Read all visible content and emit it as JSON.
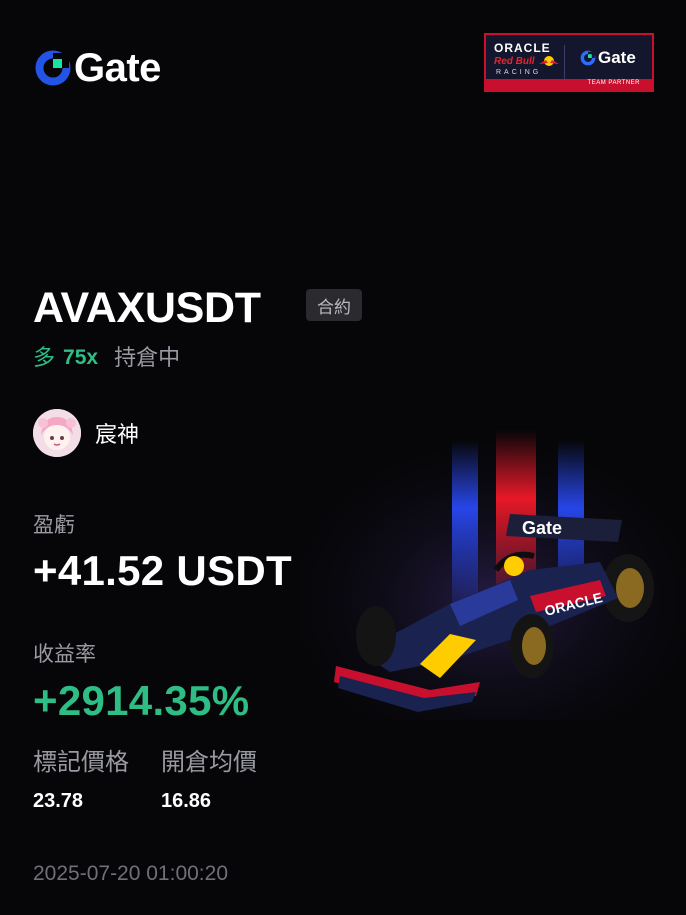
{
  "brand": {
    "logo_text": "Gate",
    "logo_icon": "gate-logo-icon"
  },
  "partner": {
    "line1": "ORACLE",
    "line2": "Red Bull",
    "line3": "RACING",
    "brand": "Gate",
    "footer": "TEAM PARTNER"
  },
  "position": {
    "pair": "AVAXUSDT",
    "type_badge": "合約",
    "direction": "多",
    "leverage": "75x",
    "status": "持倉中"
  },
  "user": {
    "name": "宸神",
    "avatar_icon": "user-avatar"
  },
  "pnl": {
    "label": "盈虧",
    "value": "+41.52 USDT"
  },
  "roi": {
    "label": "收益率",
    "value": "+2914.35%"
  },
  "prices": {
    "mark_label": "標記價格",
    "mark_value": "23.78",
    "entry_label": "開倉均價",
    "entry_value": "16.86"
  },
  "timestamp": "2025-07-20 01:00:20",
  "colors": {
    "background": "#060608",
    "positive": "#2fbd86",
    "muted": "#9a9aa2",
    "brand_blue": "#2354e6",
    "brand_green": "#17e6a1",
    "partner_red": "#c8102e",
    "partner_navy": "#13162c"
  }
}
